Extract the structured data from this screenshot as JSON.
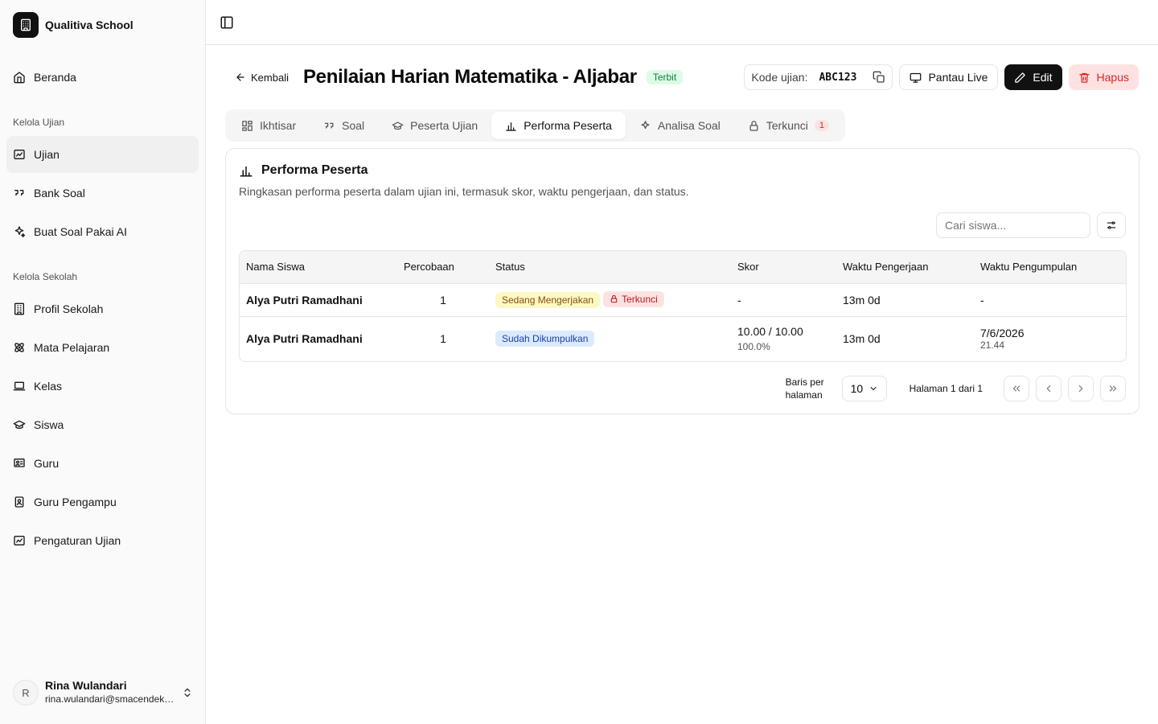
{
  "brand": {
    "name": "Qualitiva School"
  },
  "sidebar": {
    "home": "Beranda",
    "group1": "Kelola Ujian",
    "group1_items": [
      "Ujian",
      "Bank Soal",
      "Buat Soal Pakai AI"
    ],
    "group2": "Kelola Sekolah",
    "group2_items": [
      "Profil Sekolah",
      "Mata Pelajaran",
      "Kelas",
      "Siswa",
      "Guru",
      "Guru Pengampu",
      "Pengaturan Ujian"
    ]
  },
  "user": {
    "initial": "R",
    "name": "Rina Wulandari",
    "email": "rina.wulandari@smacendekia.sch.id"
  },
  "header": {
    "back": "Kembali",
    "title": "Penilaian Harian Matematika - Aljabar",
    "status_badge": "Terbit",
    "code_label": "Kode ujian:",
    "code_value": "ABC123",
    "live_button": "Pantau Live",
    "edit_button": "Edit",
    "delete_button": "Hapus"
  },
  "tabs": [
    {
      "label": "Ikhtisar",
      "icon": "grid-icon"
    },
    {
      "label": "Soal",
      "icon": "quote-icon"
    },
    {
      "label": "Peserta Ujian",
      "icon": "graduation-cap-icon"
    },
    {
      "label": "Performa Peserta",
      "icon": "bar-chart-icon",
      "active": true
    },
    {
      "label": "Analisa Soal",
      "icon": "sparkles-icon"
    },
    {
      "label": "Terkunci",
      "icon": "lock-icon",
      "count": "1"
    }
  ],
  "card": {
    "title": "Performa Peserta",
    "description": "Ringkasan performa peserta dalam ujian ini, termasuk skor, waktu pengerjaan, dan status.",
    "search_placeholder": "Cari siswa..."
  },
  "table": {
    "columns": [
      "Nama Siswa",
      "Percobaan",
      "Status",
      "Skor",
      "Waktu Pengerjaan",
      "Waktu Pengumpulan"
    ],
    "rows": [
      {
        "name": "Alya Putri Ramadhani",
        "attempt": "1",
        "status": "Sedang Mengerjakan",
        "status2": "Terkunci",
        "score": "-",
        "duration": "13m 0d",
        "submitted": "-"
      },
      {
        "name": "Alya Putri Ramadhani",
        "attempt": "1",
        "status": "Sudah Dikumpulkan",
        "score": "10.00 / 10.00",
        "score_pct": "100.0%",
        "duration": "13m 0d",
        "submitted": "7/6/2026",
        "submitted_time": "21.44"
      }
    ]
  },
  "pagination": {
    "rows_label": "Baris per halaman",
    "rows_value": "10",
    "page_info": "Halaman 1 dari 1"
  }
}
